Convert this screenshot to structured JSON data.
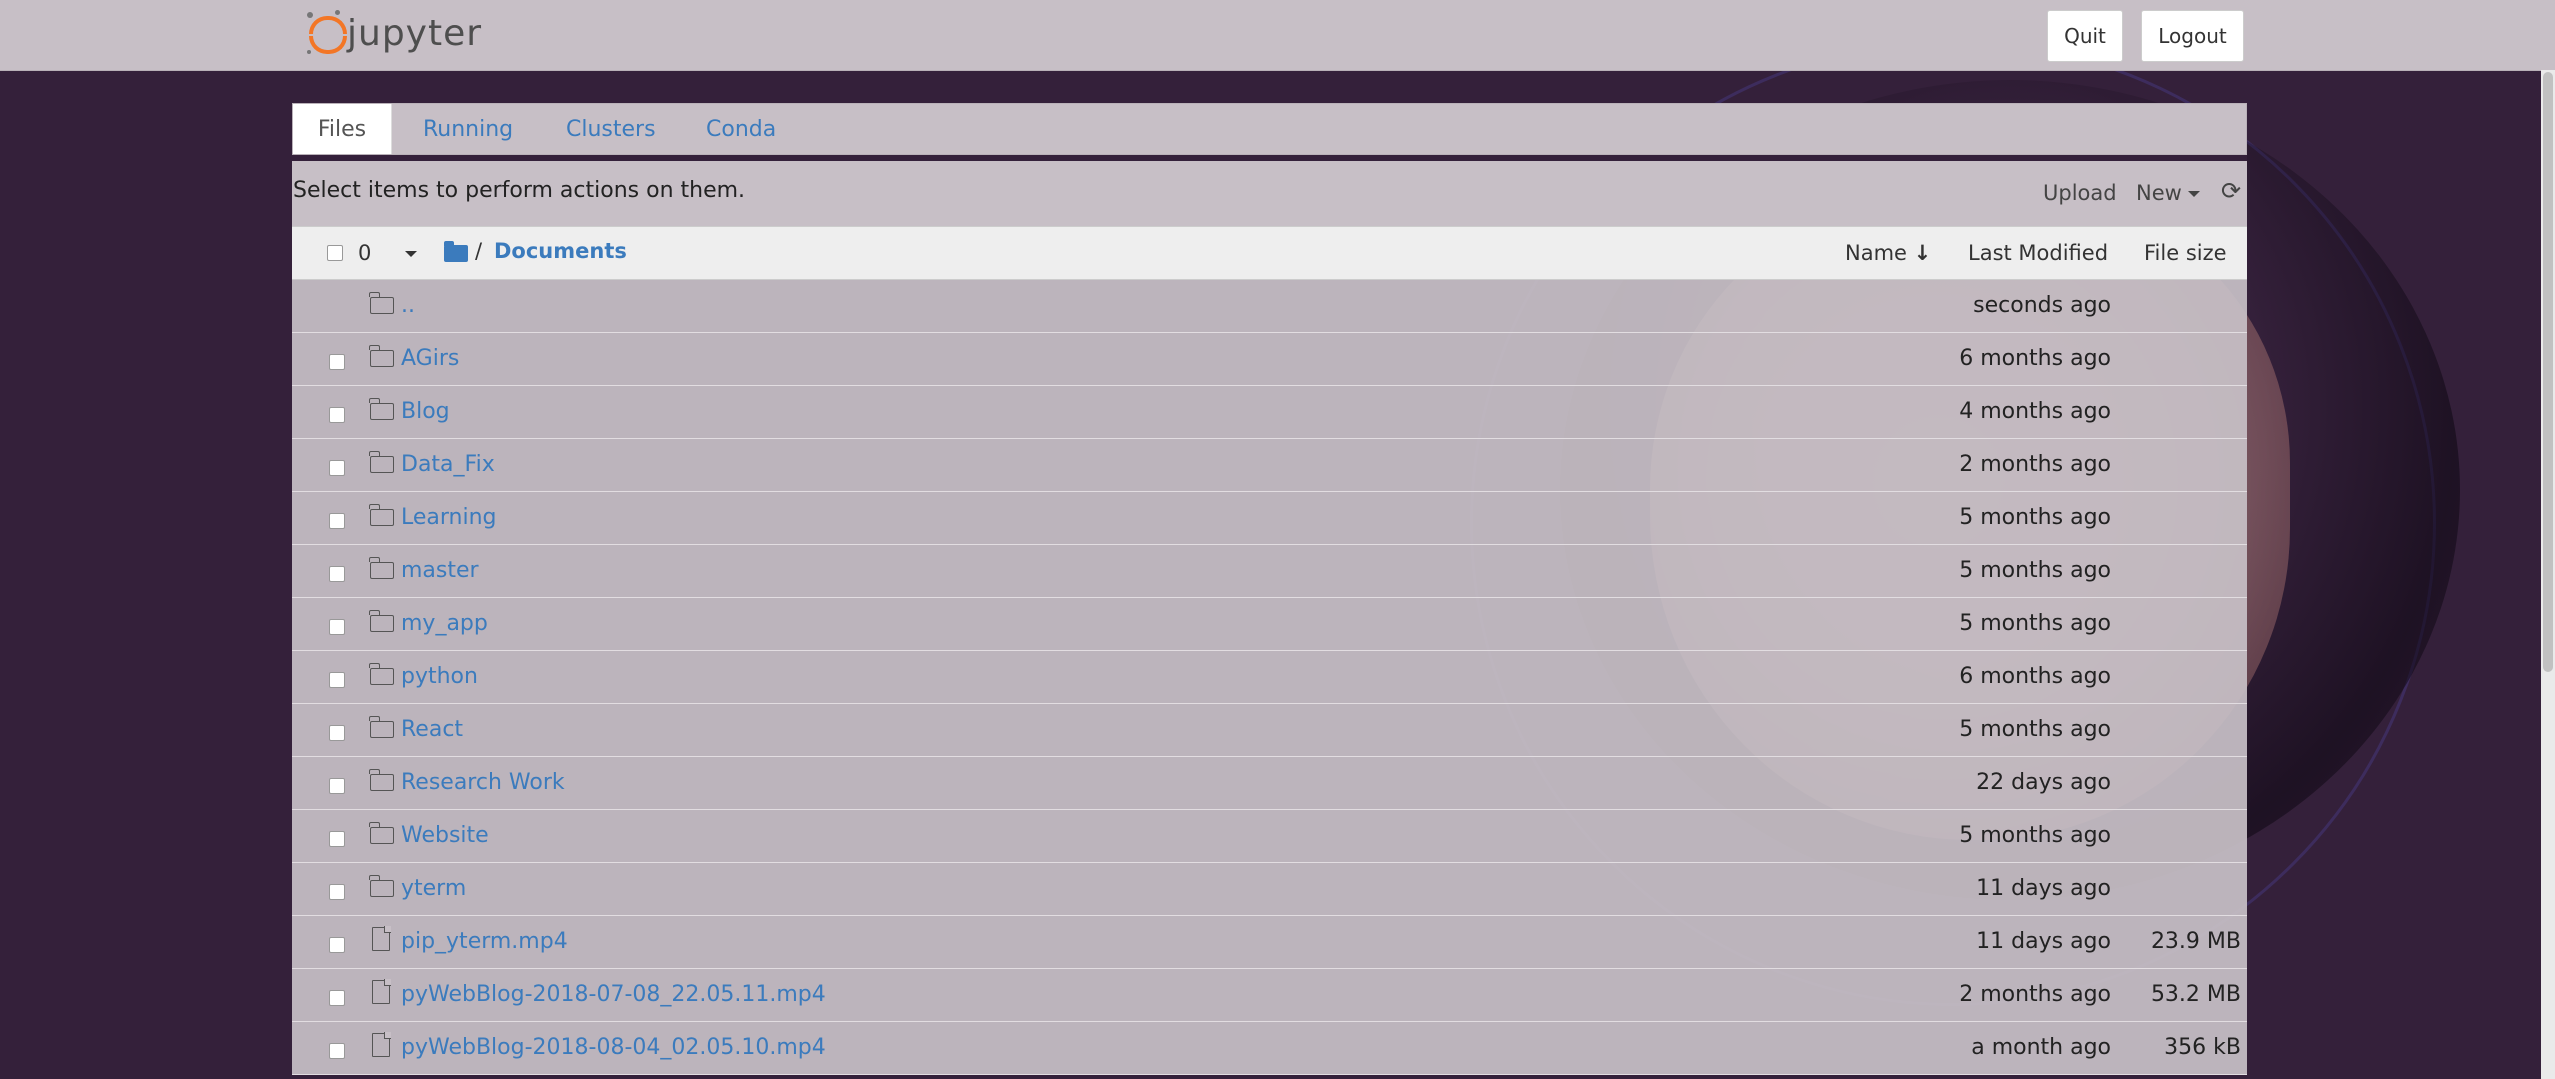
{
  "header": {
    "logo_text": "jupyter",
    "quit_label": "Quit",
    "logout_label": "Logout"
  },
  "tabs": [
    {
      "label": "Files",
      "active": true
    },
    {
      "label": "Running",
      "active": false
    },
    {
      "label": "Clusters",
      "active": false
    },
    {
      "label": "Conda",
      "active": false
    }
  ],
  "toolbar": {
    "hint": "Select items to perform actions on them.",
    "upload_label": "Upload",
    "new_label": "New"
  },
  "list_header": {
    "selected_count": "0",
    "path_sep": "/",
    "path_current": "Documents",
    "col_name": "Name",
    "col_modified": "Last Modified",
    "col_size": "File size"
  },
  "files": [
    {
      "type": "folder",
      "name": "..",
      "modified": "seconds ago",
      "size": "",
      "checkbox": false
    },
    {
      "type": "folder",
      "name": "AGirs",
      "modified": "6 months ago",
      "size": "",
      "checkbox": true
    },
    {
      "type": "folder",
      "name": "Blog",
      "modified": "4 months ago",
      "size": "",
      "checkbox": true
    },
    {
      "type": "folder",
      "name": "Data_Fix",
      "modified": "2 months ago",
      "size": "",
      "checkbox": true
    },
    {
      "type": "folder",
      "name": "Learning",
      "modified": "5 months ago",
      "size": "",
      "checkbox": true
    },
    {
      "type": "folder",
      "name": "master",
      "modified": "5 months ago",
      "size": "",
      "checkbox": true
    },
    {
      "type": "folder",
      "name": "my_app",
      "modified": "5 months ago",
      "size": "",
      "checkbox": true
    },
    {
      "type": "folder",
      "name": "python",
      "modified": "6 months ago",
      "size": "",
      "checkbox": true
    },
    {
      "type": "folder",
      "name": "React",
      "modified": "5 months ago",
      "size": "",
      "checkbox": true
    },
    {
      "type": "folder",
      "name": "Research Work",
      "modified": "22 days ago",
      "size": "",
      "checkbox": true
    },
    {
      "type": "folder",
      "name": "Website",
      "modified": "5 months ago",
      "size": "",
      "checkbox": true
    },
    {
      "type": "folder",
      "name": "yterm",
      "modified": "11 days ago",
      "size": "",
      "checkbox": true
    },
    {
      "type": "file",
      "name": "pip_yterm.mp4",
      "modified": "11 days ago",
      "size": "23.9 MB",
      "checkbox": true
    },
    {
      "type": "file",
      "name": "pyWebBlog-2018-07-08_22.05.11.mp4",
      "modified": "2 months ago",
      "size": "53.2 MB",
      "checkbox": true
    },
    {
      "type": "file",
      "name": "pyWebBlog-2018-08-04_02.05.10.mp4",
      "modified": "a month ago",
      "size": "356 kB",
      "checkbox": true
    }
  ],
  "colors": {
    "accent_link": "#3b7bbd",
    "logo_orange": "#f37626",
    "page_bg": "#34203a"
  }
}
